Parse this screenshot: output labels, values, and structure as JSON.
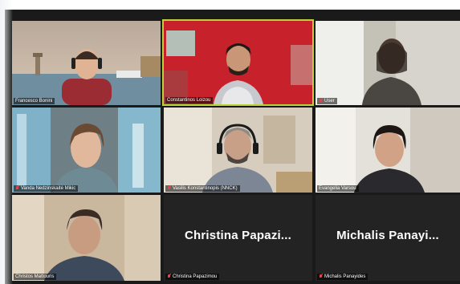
{
  "meeting": {
    "participants": [
      {
        "name": "Francesco Bonini",
        "muted": false,
        "video": true
      },
      {
        "name": "Constantinos Loizou",
        "muted": false,
        "video": true,
        "active_speaker": true
      },
      {
        "name": "User",
        "muted": true,
        "video": true
      },
      {
        "name": "Vanda Nedzinskaitė Mikic",
        "muted": true,
        "video": true
      },
      {
        "name": "Vasilis Konstantinopis (NNCK)",
        "muted": true,
        "video": true
      },
      {
        "name": "Evangelia Varsou",
        "muted": false,
        "video": true
      },
      {
        "name": "Christos Mattouris",
        "muted": false,
        "video": true
      },
      {
        "name": "Christina Papazimou",
        "display_name": "Christina  Papazi...",
        "muted": true,
        "video": false
      },
      {
        "name": "Michalis Panayides",
        "display_name": "Michalis  Panayi...",
        "muted": true,
        "video": false
      }
    ]
  },
  "colors": {
    "active_speaker_border": "#b8d43a",
    "muted_icon": "#e84545",
    "tile_background": "#232323"
  },
  "icons": {
    "muted": "microphone-muted-icon"
  }
}
